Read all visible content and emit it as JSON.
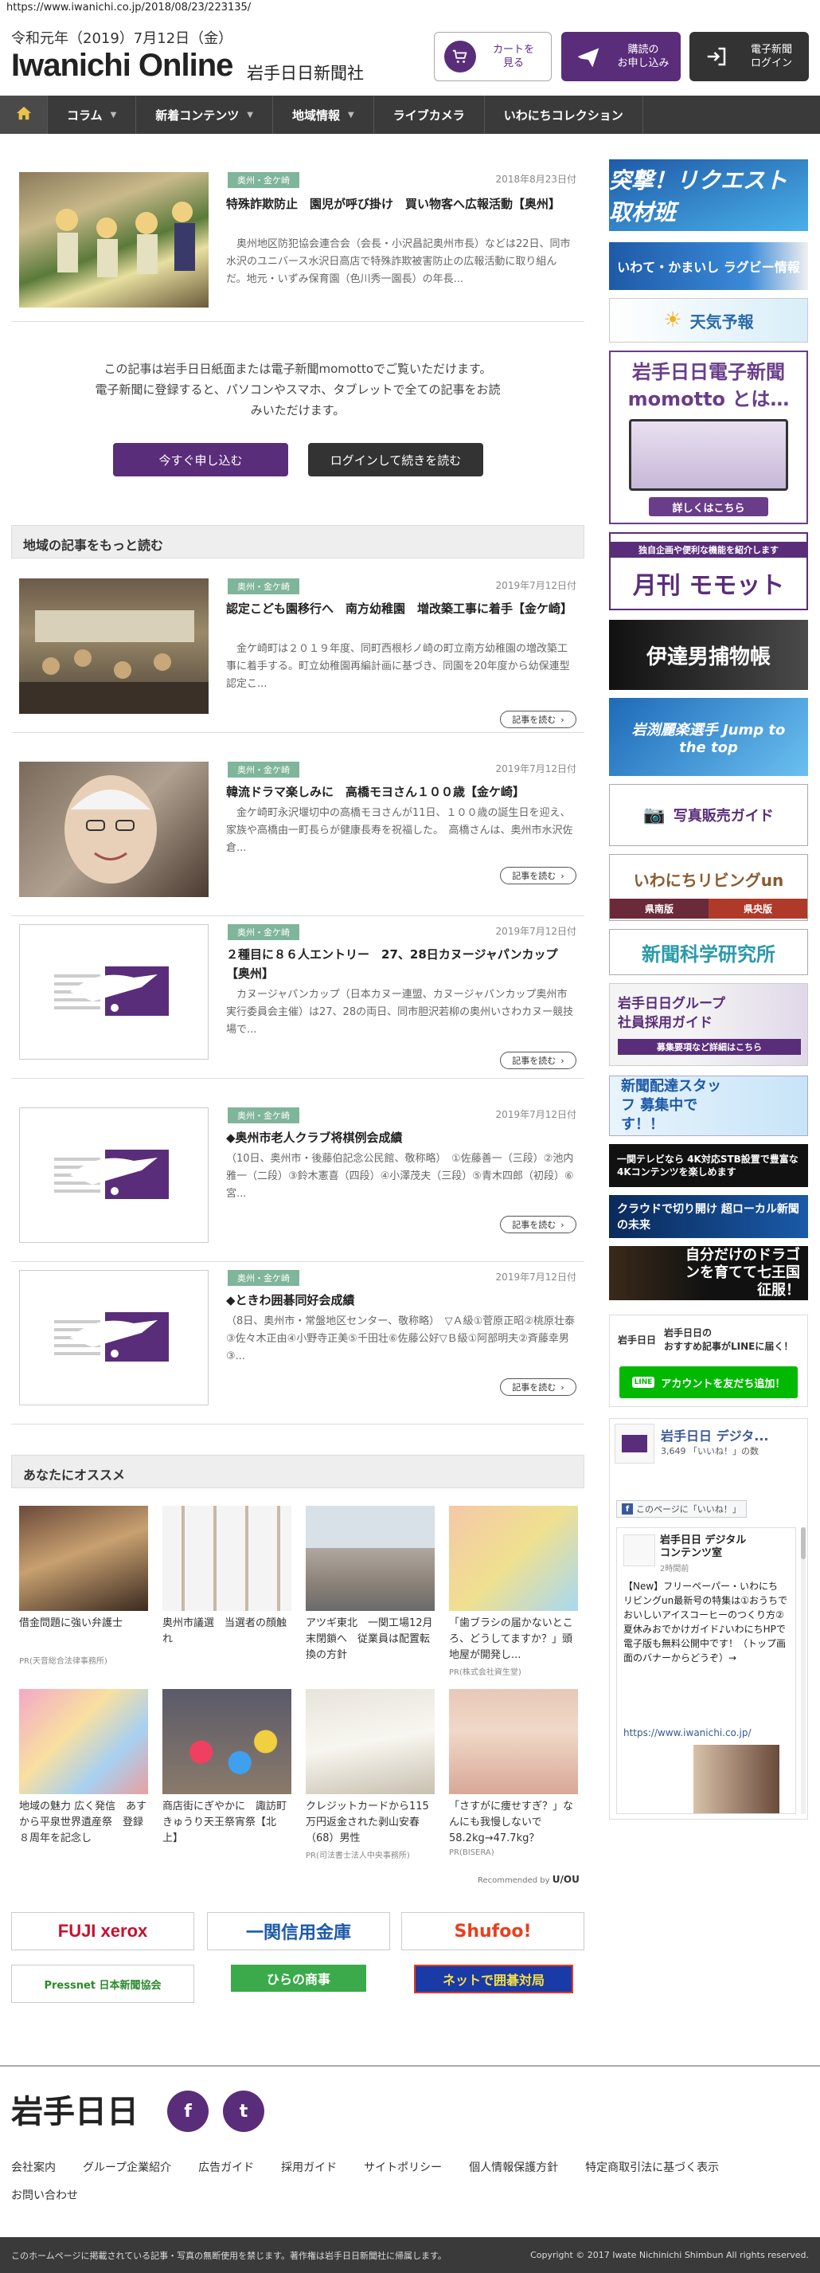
{
  "header": {
    "url": "https://www.iwanichi.co.jp/2018/08/23/223135/",
    "date": "令和元年（2019）7月12日（金）",
    "logo": "Iwanichi Online",
    "logo_sub": "岩手日日新聞社",
    "cart_label": "カートを\n見る",
    "subscribe_label": "購読の\nお申し込み",
    "login_label": "電子新聞\nログイン"
  },
  "nav": {
    "items": [
      {
        "label": "コラム",
        "caret": true
      },
      {
        "label": "新着コンテンツ",
        "caret": true
      },
      {
        "label": "地域情報",
        "caret": true
      },
      {
        "label": "ライブカメラ",
        "caret": false
      },
      {
        "label": "いわにちコレクション",
        "caret": false
      }
    ]
  },
  "featured": {
    "tag": "奥州・金ケ崎",
    "date": "2018年8月23日付",
    "title": "特殊詐欺防止　園児が呼び掛け　買い物客へ広報活動【奥州】",
    "excerpt": "奥州地区防犯協会連合会（会長・小沢昌記奥州市長）などは22日、同市水沢のユニバース水沢日高店で特殊詐欺被害防止の広報活動に取り組んだ。地元・いずみ保育園（色川秀一園長）の年長..."
  },
  "paywall": {
    "line1": "この記事は岩手日日紙面または電子新聞momottoでご覧いただけます。",
    "line2": "電子新聞に登録すると、パソコンやスマホ、タブレットで全ての記事をお読みいただけます。",
    "apply_label": "今すぐ申し込む",
    "login_label": "ログインして続きを読む"
  },
  "more_section": {
    "title": "地域の記事をもっと読む",
    "read_more": "記事を読む",
    "articles": [
      {
        "tag": "奥州・金ケ崎",
        "date": "2019年7月12日付",
        "title": "認定こども園移行へ　南方幼稚園　増改築工事に着手【金ケ崎】",
        "excerpt": "金ケ崎町は２０１９年度、同町西根杉ノ崎の町立南方幼稚園の増改築工事に着手する。町立幼稚園再編計画に基づき、同園を20年度から幼保連型認定こ..."
      },
      {
        "tag": "奥州・金ケ崎",
        "date": "2019年7月12日付",
        "title": "韓流ドラマ楽しみに　高橋モヨさん１００歳【金ケ崎】",
        "excerpt": "金ケ崎町永沢堰切中の高橋モヨさんが11日、１００歳の誕生日を迎え、家族や高橋由一町長らが健康長寿を祝福した。　高橋さんは、奥州市水沢佐倉..."
      },
      {
        "tag": "奥州・金ケ崎",
        "date": "2019年7月12日付",
        "title": "２種目に８６人エントリー　27、28日カヌージャパンカップ【奥州】",
        "excerpt": "カヌージャパンカップ（日本カヌー連盟、カヌージャパンカップ奥州市実行委員会主催）は27、28の両日、同市胆沢若柳の奥州いさわカヌー競技場で..."
      },
      {
        "tag": "奥州・金ケ崎",
        "date": "2019年7月12日付",
        "title": "◆奥州市老人クラブ将棋例会成績",
        "excerpt": "（10日、奥州市・後藤伯記念公民館、敬称略）　①佐藤善一（三段）②池内雅一（二段）③鈴木憲喜（四段）④小澤茂夫（三段）⑤青木四郎（初段）⑥宮..."
      },
      {
        "tag": "奥州・金ケ崎",
        "date": "2019年7月12日付",
        "title": "◆ときわ囲碁同好会成績",
        "excerpt": "（8日、奥州市・常盤地区センター、敬称略）　▽Ａ級①菅原正昭②桃原壮泰③佐々木正由④小野寺正美⑤千田壮⑥佐藤公好▽Ｂ級①阿部明夫②斉藤幸男③..."
      }
    ]
  },
  "recommend": {
    "title": "あなたにオススメ",
    "items": [
      {
        "title": "借金問題に強い弁護士",
        "pr": "PR(天音総合法律事務所)"
      },
      {
        "title": "奥州市議選　当選者の顔触れ",
        "pr": ""
      },
      {
        "title": "アツギ東北　一関工場12月末閉鎖へ　従業員は配置転換の方針",
        "pr": ""
      },
      {
        "title": "「歯ブラシの届かないところ、どうしてますか？」頭地屋が開発し...",
        "pr": "PR(株式会社資生堂)"
      },
      {
        "title": "地域の魅力 広く発信　あすから平泉世界遺産祭　登録８周年を記念し",
        "pr": ""
      },
      {
        "title": "商店街にぎやかに　諏訪町　きゅうり天王祭宵祭【北上】",
        "pr": ""
      },
      {
        "title": "クレジットカードから115万円返金された剥山安春（68）男性",
        "pr": "PR(司法書士法人中央事務所)"
      },
      {
        "title": "「さすがに痩せすぎ？」なんにも我慢しないで58.2kg→47.7kg？",
        "pr": "PR(BISERA)"
      }
    ],
    "credit": "Recommended by",
    "credit_brand": "U/OU"
  },
  "ads": [
    "FUJI xerox",
    "一関信用金庫",
    "Shufoo!",
    "Pressnet 日本新聞協会",
    "ひらの商事",
    "ネットで囲碁対局"
  ],
  "sidebar": {
    "banners": [
      {
        "title": "突撃！リクエスト取材班",
        "color": "#2b7fc3"
      },
      {
        "title": "いわて・かまいし ラグビー情報",
        "color": "#1e5aa8"
      },
      {
        "title": "天気予報",
        "color": "#ffffff"
      },
      {
        "title": "岩手日日電子新聞 momotto とは…",
        "sub": "詳しくはこちら",
        "color": "#6a3d8a"
      },
      {
        "title": "月刊 モモット",
        "sub": "独自企画や便利な機能を紹介します",
        "color": "#5a2d7a"
      },
      {
        "title": "伊達男捕物帳",
        "color": "#2a2a2a"
      },
      {
        "title": "岩渕麗楽選手 Jump to the top",
        "color": "#3a8fd0"
      },
      {
        "title": "写真販売ガイド",
        "color": "#ffffff"
      },
      {
        "title": "いわにちリビングun",
        "sub1": "県南版",
        "sub2": "県央版",
        "color": "#8b5a2b"
      },
      {
        "title": "新聞科学研究所",
        "color": "#ffffff"
      },
      {
        "title": "岩手日日グループ 社員採用ガイド",
        "sub": "募集要項など詳細はこちら",
        "color": "#5a2d7a"
      },
      {
        "title": "新聞配達スタッフ 募集中です！！",
        "color": "#2b7fc3"
      },
      {
        "title": "一関テレビなら 4K対応STB設置で豊富な4Kコンテンツを楽しめます",
        "color": "#111111"
      },
      {
        "title": "クラウドで切り開け 超ローカル新聞の未来",
        "color": "#1a3a6a"
      },
      {
        "title": "自分だけのドラゴンを育てて七王国征服！",
        "color": "#222222"
      }
    ],
    "line": {
      "brand": "岩手日日",
      "text": "岩手日日の\nおすすめ記事がLINEに届く！",
      "button": "アカウントを友だち追加！"
    },
    "fb": {
      "page_name": "岩手日日 デジタ...",
      "likes": "3,649 「いいね！」の数",
      "like_button": "このページに「いいね！」",
      "post_author": "岩手日日 デジタル\nコンテンツ室",
      "post_time": "2時間前",
      "post_text": "【New】フリーペーパー・いわにちリビングun最新号の特集は①おうちでおいしいアイスコーヒーのつくり方②夏休みおでかけガイド♪いわにちHPで電子版も無料公開中です！（トップ画面のバナーからどうぞ）→",
      "post_link": "https://www.iwanichi.co.jp/"
    }
  },
  "footer": {
    "logo": "岩手日日",
    "social": [
      "f",
      "t"
    ],
    "links": [
      "会社案内",
      "グループ企業紹介",
      "広告ガイド",
      "採用ガイド",
      "サイトポリシー",
      "個人情報保護方針",
      "特定商取引法に基づく表示"
    ],
    "contact": "お問い合わせ",
    "notice": "このホームページに掲載されている記事・写真の無断使用を禁じます。著作権は岩手日日新聞社に帰属します。",
    "copyright": "Copyright © 2017 Iwate Nichinichi Shimbun All rights reserved."
  },
  "colors": {
    "brand": "#5a2d7a",
    "tag": "#7fb59a",
    "nav": "#3a3a3a"
  }
}
